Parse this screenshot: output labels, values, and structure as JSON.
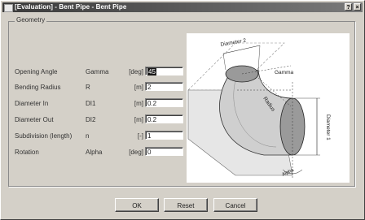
{
  "window": {
    "title": "[Evaluation] - Bent Pipe - Bent Pipe",
    "help_label": "?",
    "close_label": "×"
  },
  "group": {
    "label": "Geometry"
  },
  "fields": [
    {
      "label": "Opening Angle",
      "symbol": "Gamma",
      "unit": "[deg]",
      "value": "45"
    },
    {
      "label": "Bending Radius",
      "symbol": "R",
      "unit": "[m]",
      "value": "2"
    },
    {
      "label": "Diameter In",
      "symbol": "DI1",
      "unit": "[m]",
      "value": "0.2"
    },
    {
      "label": "Diameter Out",
      "symbol": "DI2",
      "unit": "[m]",
      "value": "0.2"
    },
    {
      "label": "Subdivision (length)",
      "symbol": "n",
      "unit": "[-]",
      "value": "1"
    },
    {
      "label": "Rotation",
      "symbol": "Alpha",
      "unit": "[deg]",
      "value": "0"
    }
  ],
  "diagram": {
    "diameter2_label": "Diameter 2",
    "gamma_label": "Gamma",
    "radius_label": "Radius",
    "diameter1_label": "Diameter 1",
    "alpha_label": "Alpha"
  },
  "buttons": {
    "ok": "OK",
    "reset": "Reset",
    "cancel": "Cancel"
  }
}
